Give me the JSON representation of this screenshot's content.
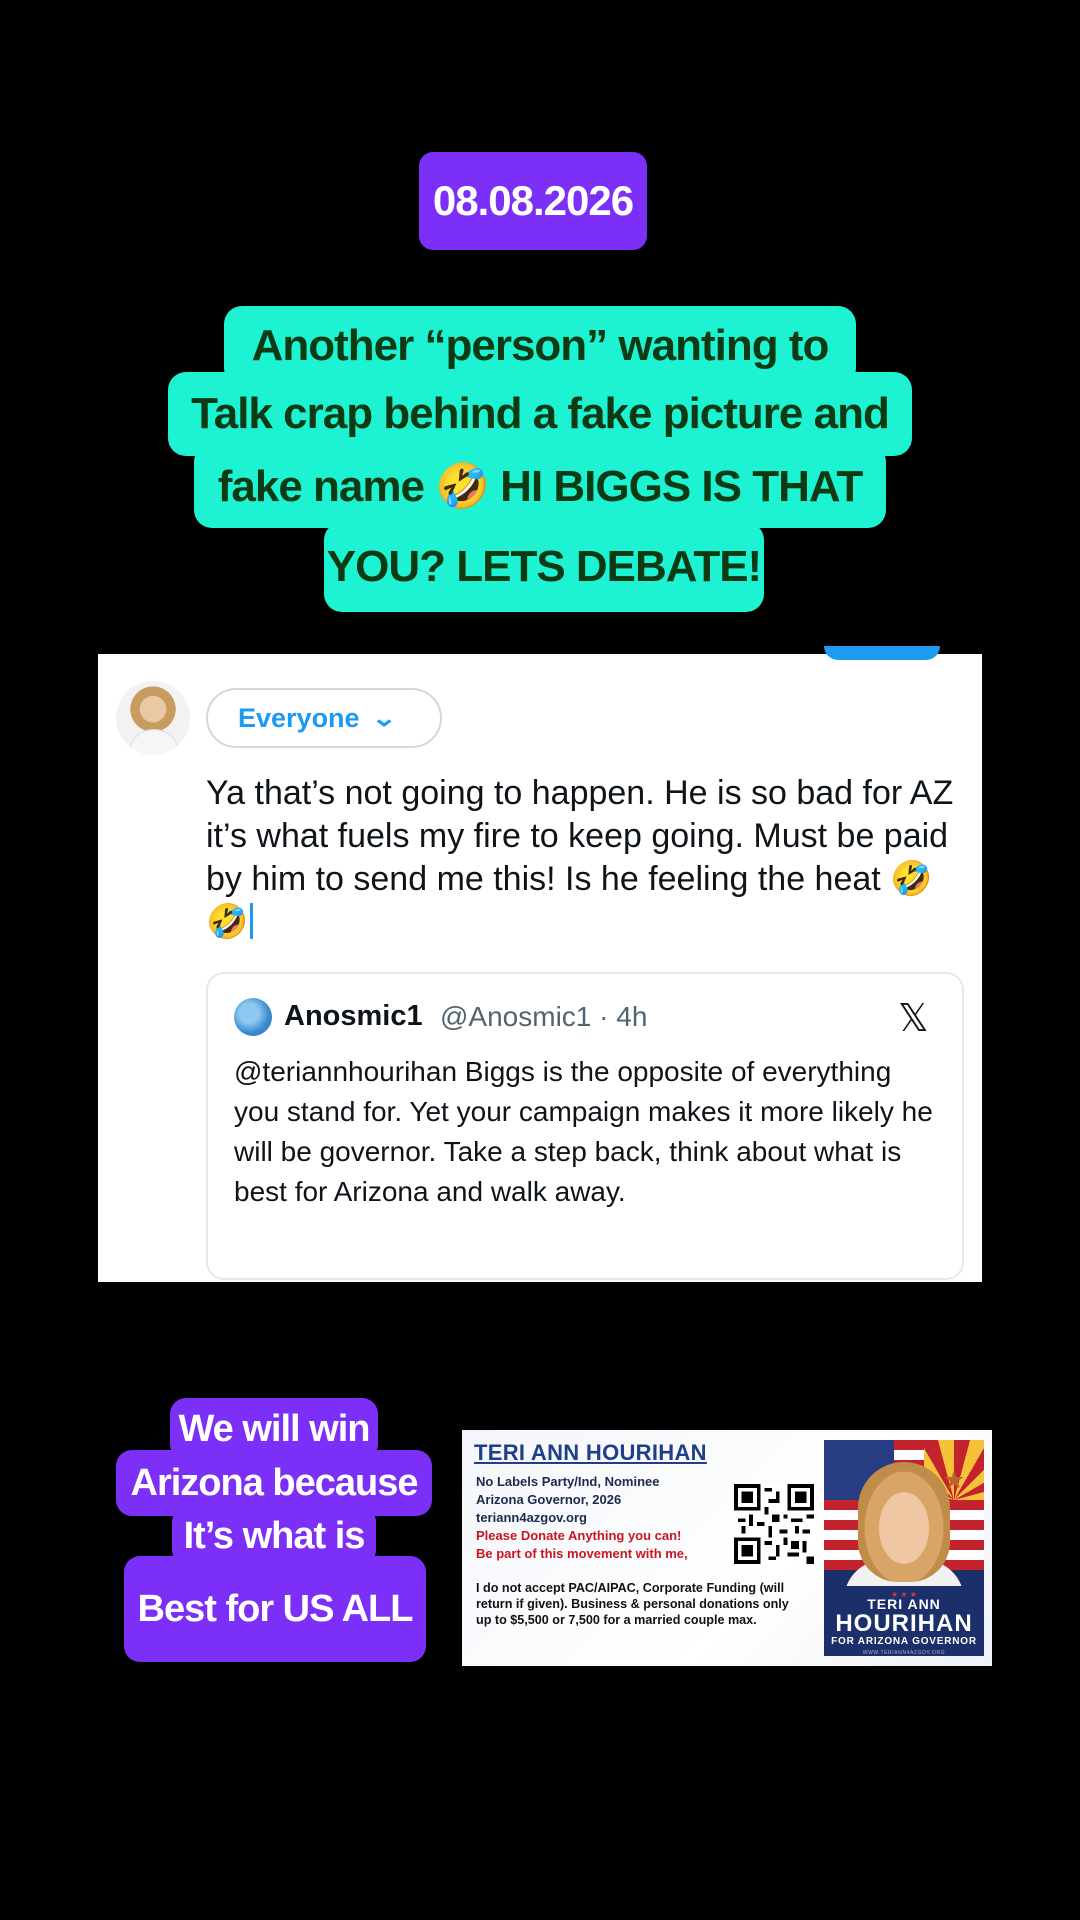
{
  "date_badge": "08.08.2026",
  "headline": {
    "lines": [
      "Another “person” wanting to",
      "Talk crap behind a fake picture and",
      "fake name 🤣 HI BIGGS IS THAT",
      "YOU? LETS DEBATE!"
    ]
  },
  "reply": {
    "audience_label": "Everyone",
    "text": "Ya that’s not going to happen. He is so bad for AZ it’s what fuels my fire to keep going. Must be paid by him to send me this! Is he feeling the heat 🤣🤣"
  },
  "quoted_tweet": {
    "display_name": "Anosmic1",
    "handle_time": "@Anosmic1 · 4h",
    "text": "@teriannhourihan Biggs is the opposite of everything you stand for. Yet your campaign makes it more likely he will be governor. Take a step back,  think about what is best for Arizona and walk away."
  },
  "caption_bottom": {
    "lines": [
      "We will win",
      "Arizona because",
      "It’s what is",
      "Best for US ALL"
    ]
  },
  "campaign_card": {
    "name": "TERI ANN HOURIHAN",
    "line1": "No Labels Party/Ind, Nominee",
    "line2": "Arizona Governor, 2026",
    "line3": "teriann4azgov.org",
    "line4": "Please Donate Anything you can!",
    "line5": "Be part of this movement with me,",
    "body": "I do not accept PAC/AIPAC, Corporate Funding (will return if given). Business & personal donations only up to $5,500  or 7,500 for a married couple max.",
    "photo_stars": "★ ★ ★",
    "photo_name1": "TERI ANN",
    "photo_name2": "HOURIHAN",
    "photo_sub": "FOR ARIZONA GOVERNOR",
    "photo_url": "WWW.TERIANN4AZGOV.ORG"
  },
  "colors": {
    "background": "#000000",
    "purple": "#7b2ff7",
    "aqua": "#1df2d2",
    "headline_text": "#0d3a12",
    "twitter_blue": "#1d9bf0"
  }
}
